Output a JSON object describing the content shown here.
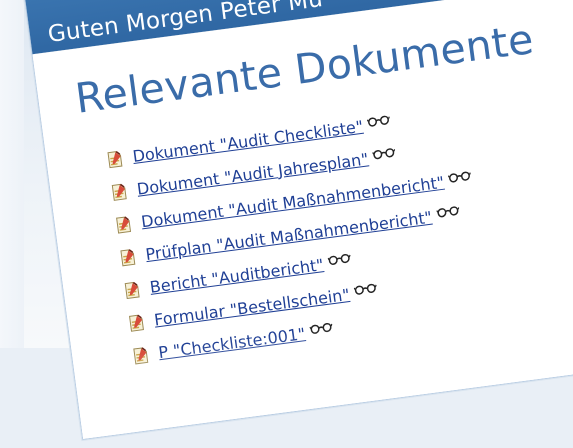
{
  "header": {
    "greeting": "Guten Morgen Peter Mu"
  },
  "main": {
    "section_title": "Relevante Dokumente",
    "documents": [
      {
        "label": "Dokument \"Audit Checkliste\""
      },
      {
        "label": "Dokument \"Audit Jahresplan\""
      },
      {
        "label": "Dokument \"Audit Maßnahmenbericht\""
      },
      {
        "label": "Prüfplan \"Audit Maßnahmenbericht\""
      },
      {
        "label": "Bericht \"Auditbericht\""
      },
      {
        "label": "Formular \"Bestellschein\""
      },
      {
        "label": "P \"Checkliste:001\""
      }
    ]
  },
  "colors": {
    "titlebar": "#2f67a3",
    "link": "#1f3f95",
    "section_title": "#3a6ca9",
    "background": "#e9eff6"
  },
  "icons": {
    "document": "document-icon",
    "view": "glasses-icon"
  }
}
